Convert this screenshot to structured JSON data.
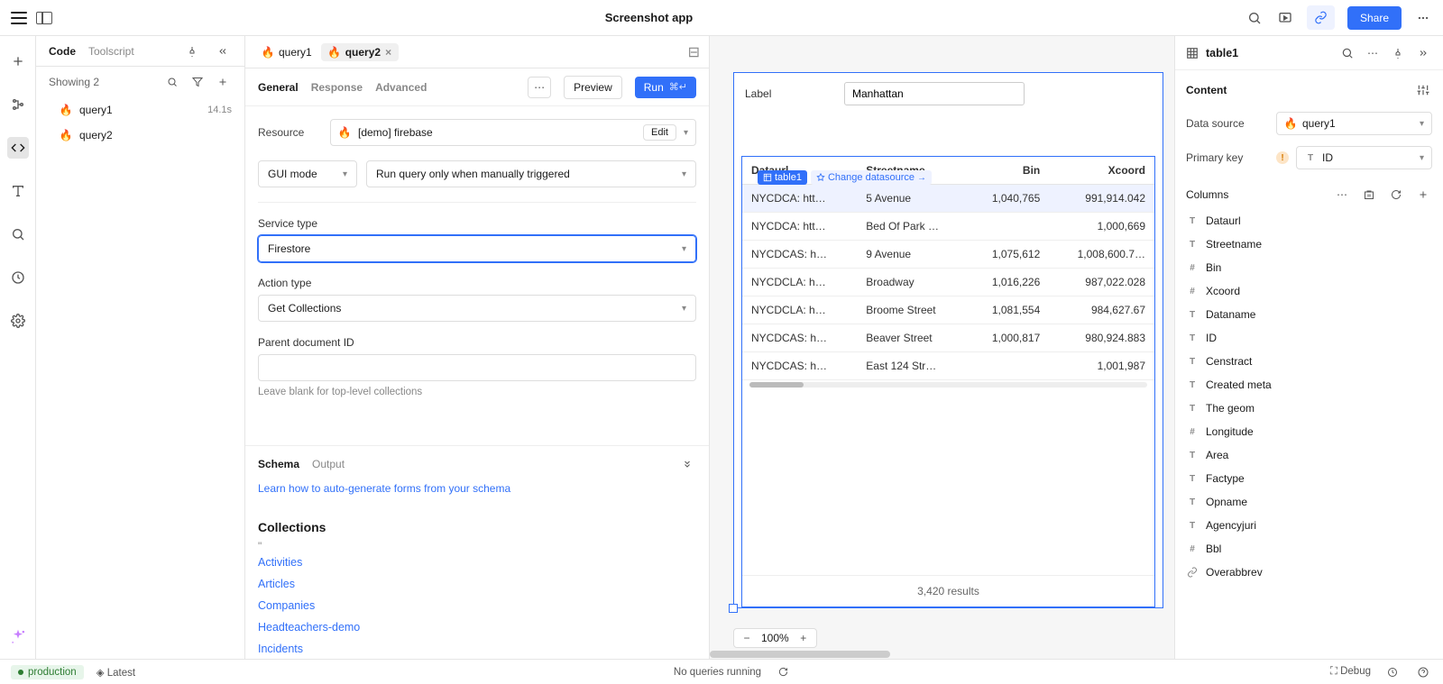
{
  "app_title": "Screenshot app",
  "share_label": "Share",
  "code_sidebar": {
    "tabs": [
      "Code",
      "Toolscript"
    ],
    "showing": "Showing 2",
    "queries": [
      {
        "name": "query1",
        "time": "14.1s"
      },
      {
        "name": "query2",
        "time": ""
      }
    ]
  },
  "editor": {
    "tabs": [
      {
        "name": "query1",
        "active": false
      },
      {
        "name": "query2",
        "active": true
      }
    ],
    "sub_tabs": [
      "General",
      "Response",
      "Advanced"
    ],
    "preview": "Preview",
    "run": "Run",
    "run_kbd": "⌘↵",
    "resource_label": "Resource",
    "resource_value": "[demo] firebase",
    "edit": "Edit",
    "gui_mode": "GUI mode",
    "trigger": "Run query only when manually triggered",
    "service_type_label": "Service type",
    "service_type_value": "Firestore",
    "action_type_label": "Action type",
    "action_type_value": "Get Collections",
    "parent_doc_label": "Parent document ID",
    "parent_doc_hint": "Leave blank for top-level collections",
    "schema_tabs": [
      "Schema",
      "Output"
    ],
    "schema_link": "Learn how to auto-generate forms from your schema",
    "collections_heading": "Collections",
    "collections": [
      "Activities",
      "Articles",
      "Companies",
      "Headteachers-demo",
      "Incidents"
    ]
  },
  "canvas": {
    "label_label": "Label",
    "label_value": "Manhattan",
    "table_tag": "table1",
    "change_ds": "Change datasource",
    "zoom": "100%",
    "results": "3,420 results",
    "headers": [
      "Dataurl",
      "Streetname",
      "Bin",
      "Xcoord"
    ],
    "rows": [
      {
        "dataurl": "NYCDCA: htt…",
        "street": "5 Avenue",
        "bin": "1,040,765",
        "xcoord": "991,914.042"
      },
      {
        "dataurl": "NYCDCA: htt…",
        "street": "Bed Of Park …",
        "bin": "",
        "xcoord": "1,000,669"
      },
      {
        "dataurl": "NYCDCAS: h…",
        "street": "9 Avenue",
        "bin": "1,075,612",
        "xcoord": "1,008,600.7…"
      },
      {
        "dataurl": "NYCDCLA: h…",
        "street": "Broadway",
        "bin": "1,016,226",
        "xcoord": "987,022.028"
      },
      {
        "dataurl": "NYCDCLA: h…",
        "street": "Broome Street",
        "bin": "1,081,554",
        "xcoord": "984,627.67"
      },
      {
        "dataurl": "NYCDCAS: h…",
        "street": "Beaver Street",
        "bin": "1,000,817",
        "xcoord": "980,924.883"
      },
      {
        "dataurl": "NYCDCAS: h…",
        "street": "East 124 Str…",
        "bin": "",
        "xcoord": "1,001,987"
      }
    ]
  },
  "inspector": {
    "title": "table1",
    "content": "Content",
    "data_source": "Data source",
    "data_source_value": "query1",
    "primary_key": "Primary key",
    "primary_key_value": "ID",
    "columns_label": "Columns",
    "columns": [
      {
        "name": "Dataurl",
        "type": "T"
      },
      {
        "name": "Streetname",
        "type": "T"
      },
      {
        "name": "Bin",
        "type": "#"
      },
      {
        "name": "Xcoord",
        "type": "#"
      },
      {
        "name": "Dataname",
        "type": "T"
      },
      {
        "name": "ID",
        "type": "T"
      },
      {
        "name": "Censtract",
        "type": "T"
      },
      {
        "name": "Created meta",
        "type": "T"
      },
      {
        "name": "The geom",
        "type": "T"
      },
      {
        "name": "Longitude",
        "type": "#"
      },
      {
        "name": "Area",
        "type": "T"
      },
      {
        "name": "Factype",
        "type": "T"
      },
      {
        "name": "Opname",
        "type": "T"
      },
      {
        "name": "Agencyjuri",
        "type": "T"
      },
      {
        "name": "Bbl",
        "type": "#"
      },
      {
        "name": "Overabbrev",
        "type": "link"
      }
    ]
  },
  "footer": {
    "env": "production",
    "latest": "Latest",
    "queries": "No queries running",
    "debug": "Debug"
  }
}
